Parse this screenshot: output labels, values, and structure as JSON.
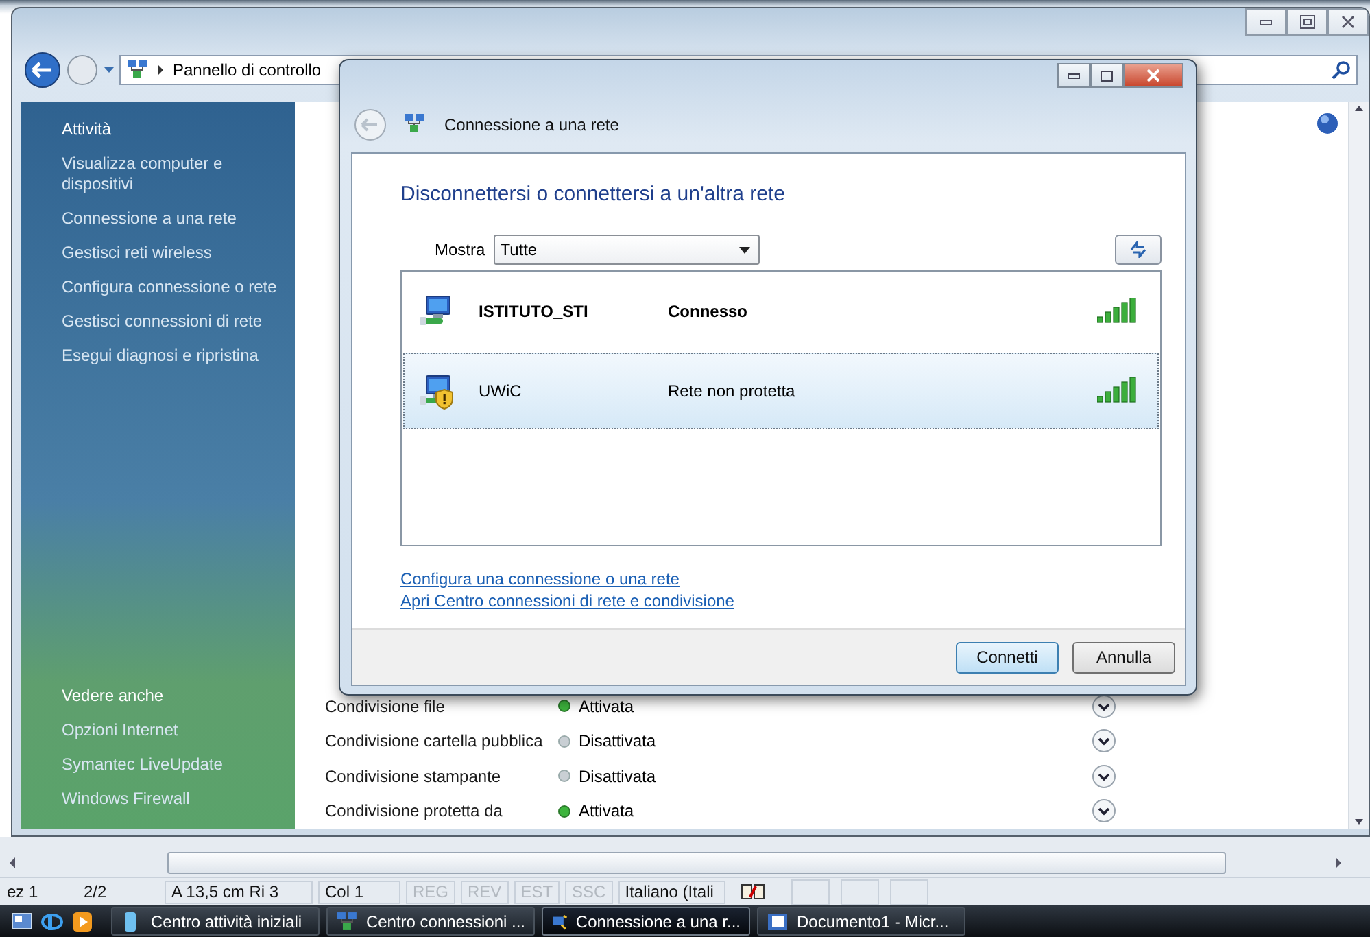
{
  "control_panel": {
    "address": "Pannello di controllo",
    "sidebar": {
      "tasks_heading": "Attività",
      "tasks": [
        "Visualizza computer e dispositivi",
        "Connessione a una rete",
        "Gestisci reti wireless",
        "Configura connessione o rete",
        "Gestisci connessioni di rete",
        "Esegui diagnosi e ripristina"
      ],
      "see_also_heading": "Vedere anche",
      "see_also": [
        "Opzioni Internet",
        "Symantec LiveUpdate",
        "Windows Firewall"
      ]
    },
    "sharing": [
      {
        "label": "Condivisione file",
        "status": "Attivata",
        "on": true
      },
      {
        "label": "Condivisione cartella pubblica",
        "status": "Disattivata",
        "on": false
      },
      {
        "label": "Condivisione stampante",
        "status": "Disattivata",
        "on": false
      },
      {
        "label": "Condivisione protetta da",
        "status": "Attivata",
        "on": true
      }
    ]
  },
  "dialog": {
    "title": "Connessione a una rete",
    "heading": "Disconnettersi o connettersi a un'altra rete",
    "filter": {
      "label": "Mostra",
      "value": "Tutte"
    },
    "networks": [
      {
        "name": "ISTITUTO_STI",
        "status": "Connesso",
        "connected": true,
        "kind": "secured",
        "selected": false
      },
      {
        "name": "UWiC",
        "status": "Rete non protetta",
        "connected": false,
        "kind": "unsecured",
        "selected": true
      }
    ],
    "links": [
      "Configura una connessione o una rete",
      "Apri Centro connessioni di rete e condivisione"
    ],
    "buttons": [
      {
        "label": "Connetti",
        "default": true
      },
      {
        "label": "Annulla",
        "default": false
      }
    ]
  },
  "word": {
    "status_bar": [
      {
        "text": "ez 1",
        "disabled": false
      },
      {
        "text": "2/2",
        "disabled": false
      },
      {
        "text": "A 13,5 cm  Ri 3",
        "disabled": false
      },
      {
        "text": "Col 1",
        "disabled": false
      },
      {
        "text": "REG",
        "disabled": true
      },
      {
        "text": "REV",
        "disabled": true
      },
      {
        "text": "EST",
        "disabled": true
      },
      {
        "text": "SSC",
        "disabled": true
      },
      {
        "text": "Italiano (Itali",
        "disabled": false
      }
    ]
  },
  "taskbar": {
    "items": [
      {
        "label": "Centro attività iniziali",
        "kind": "window",
        "selected": false
      },
      {
        "label": "Centro connessioni ...",
        "kind": "network",
        "selected": false
      },
      {
        "label": "Connessione a una r...",
        "kind": "wizard",
        "selected": true
      },
      {
        "label": "Documento1 - Micr...",
        "kind": "document",
        "selected": false
      }
    ]
  }
}
